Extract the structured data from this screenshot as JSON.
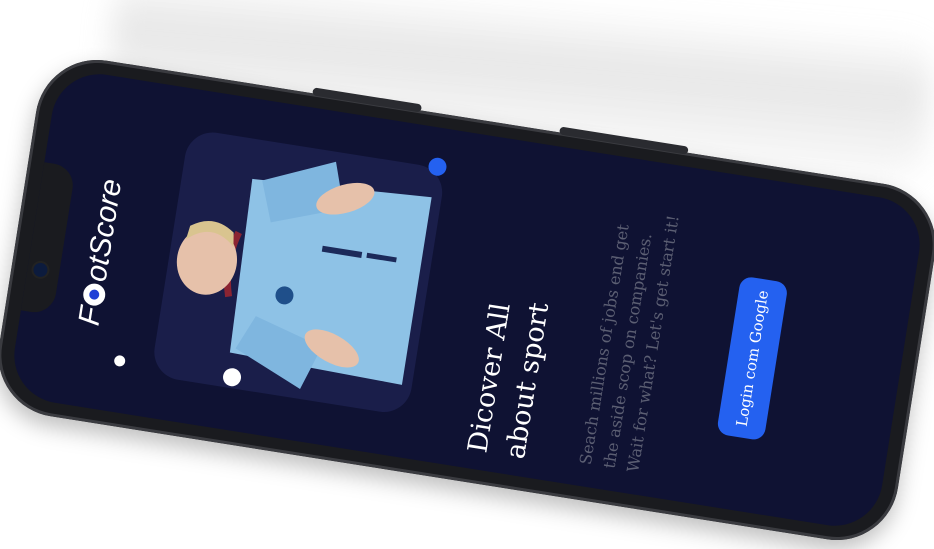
{
  "app": {
    "logo_prefix": "F",
    "logo_suffix": "otScore"
  },
  "hero": {
    "headline": "Dicover All about sport",
    "description": "Seach millions of jobs end get the aside scop on companies. Wait for what? Let's get start it!"
  },
  "actions": {
    "login_label": "Login com Google"
  },
  "colors": {
    "screen_bg": "#0f1233",
    "card_bg": "#1a1e4a",
    "accent": "#2461f0",
    "muted_text": "#5c5f73"
  },
  "icons": [
    "football-icon",
    "front-camera-icon"
  ]
}
